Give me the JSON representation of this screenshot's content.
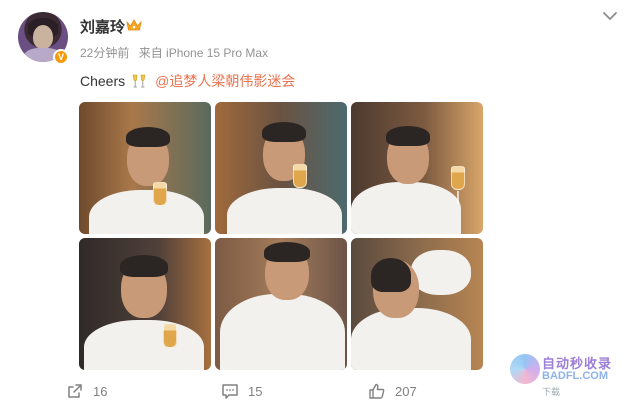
{
  "user": {
    "name": "刘嘉玲",
    "avatar": "avatar",
    "verified_badge": "V"
  },
  "meta": {
    "time": "22分钟前",
    "source": "来自 iPhone 15 Pro Max"
  },
  "post": {
    "text": "Cheers",
    "emoji": "cheers-emoji",
    "mention": "@追梦人梁朝伟影迷会"
  },
  "photos": [
    {
      "alt": "photo-1"
    },
    {
      "alt": "photo-2"
    },
    {
      "alt": "photo-3"
    },
    {
      "alt": "photo-4"
    },
    {
      "alt": "photo-5"
    },
    {
      "alt": "photo-6"
    }
  ],
  "actions": {
    "repost_count": "16",
    "comment_count": "15",
    "like_count": "207"
  },
  "watermark": {
    "title": "自动秒收录",
    "url": "BADFL.COM",
    "sub": "下载"
  },
  "colors": {
    "mention": "#eb7350",
    "meta": "#939393",
    "badge": "#f59a0b"
  }
}
